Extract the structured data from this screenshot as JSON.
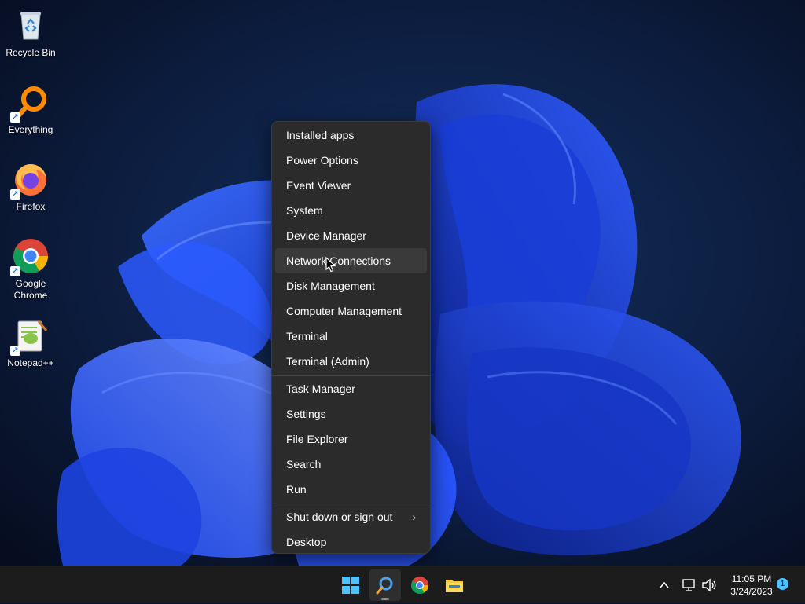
{
  "desktop": {
    "icons": [
      {
        "label": "Recycle Bin",
        "icon": "recycle-bin-icon"
      },
      {
        "label": "Everything",
        "icon": "everything-search-icon"
      },
      {
        "label": "Firefox",
        "icon": "firefox-icon"
      },
      {
        "label": "Google Chrome",
        "icon": "chrome-icon"
      },
      {
        "label": "Notepad++",
        "icon": "notepad-plus-plus-icon"
      }
    ]
  },
  "context_menu": {
    "group1": [
      "Installed apps",
      "Power Options",
      "Event Viewer",
      "System",
      "Device Manager",
      "Network Connections",
      "Disk Management",
      "Computer Management",
      "Terminal",
      "Terminal (Admin)"
    ],
    "group2": [
      "Task Manager",
      "Settings",
      "File Explorer",
      "Search",
      "Run"
    ],
    "group3": [
      "Shut down or sign out",
      "Desktop"
    ],
    "hovered_item": "Network Connections",
    "submenu_chevron": "›"
  },
  "taskbar": {
    "apps": [
      "start-button",
      "search-button",
      "chrome",
      "file-explorer"
    ],
    "tray": {
      "overflow_glyph": "^",
      "time": "11:05 PM",
      "date": "3/24/2023",
      "notification_count": "1"
    }
  },
  "colors": {
    "accent": "#4cc2ff",
    "menu_bg": "#2b2b2b",
    "taskbar_bg": "#1c1c1c",
    "wallpaper_bloom": "#1f4fff"
  }
}
